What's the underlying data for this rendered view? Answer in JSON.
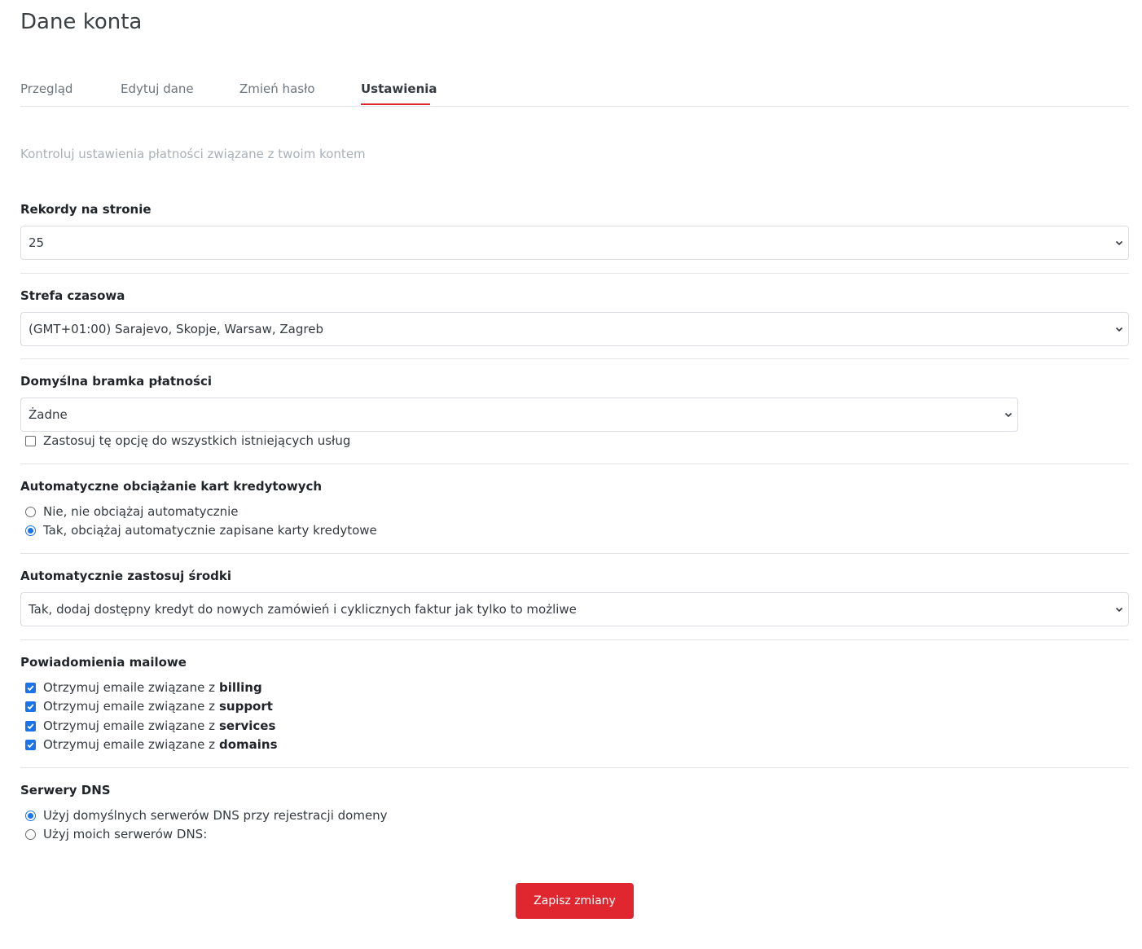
{
  "page": {
    "title": "Dane konta"
  },
  "tabs": [
    {
      "label": "Przegląd",
      "active": false
    },
    {
      "label": "Edytuj dane",
      "active": false
    },
    {
      "label": "Zmień hasło",
      "active": false
    },
    {
      "label": "Ustawienia",
      "active": true
    }
  ],
  "subtitle": "Kontroluj ustawienia płatności związane z twoim kontem",
  "records": {
    "label": "Rekordy na stronie",
    "value": "25"
  },
  "timezone": {
    "label": "Strefa czasowa",
    "value": "(GMT+01:00) Sarajevo, Skopje, Warsaw, Zagreb"
  },
  "gateway": {
    "label": "Domyślna bramka płatności",
    "value": "Żadne",
    "apply_all_label": "Zastosuj tę opcję do wszystkich istniejących usług",
    "apply_all_checked": false
  },
  "autocharge": {
    "label": "Automatyczne obciążanie kart kredytowych",
    "options": [
      {
        "label": "Nie, nie obciążaj automatycznie",
        "checked": false
      },
      {
        "label": "Tak, obciążaj automatycznie zapisane karty kredytowe",
        "checked": true
      }
    ]
  },
  "credits": {
    "label": "Automatycznie zastosuj środki",
    "value": "Tak, dodaj dostępny kredyt do nowych zamówień i cyklicznych faktur jak tylko to możliwe"
  },
  "notifications": {
    "label": "Powiadomienia mailowe",
    "prefix": "Otrzymuj emaile związane z",
    "items": [
      {
        "topic": "billing",
        "checked": true
      },
      {
        "topic": "support",
        "checked": true
      },
      {
        "topic": "services",
        "checked": true
      },
      {
        "topic": "domains",
        "checked": true
      }
    ]
  },
  "dns": {
    "label": "Serwery DNS",
    "options": [
      {
        "label": "Użyj domyślnych serwerów DNS przy rejestracji domeny",
        "checked": true
      },
      {
        "label": "Użyj moich serwerów DNS:",
        "checked": false
      }
    ]
  },
  "save_label": "Zapisz zmiany",
  "colors": {
    "accent": "#e0262f",
    "check": "#1a73e8"
  }
}
